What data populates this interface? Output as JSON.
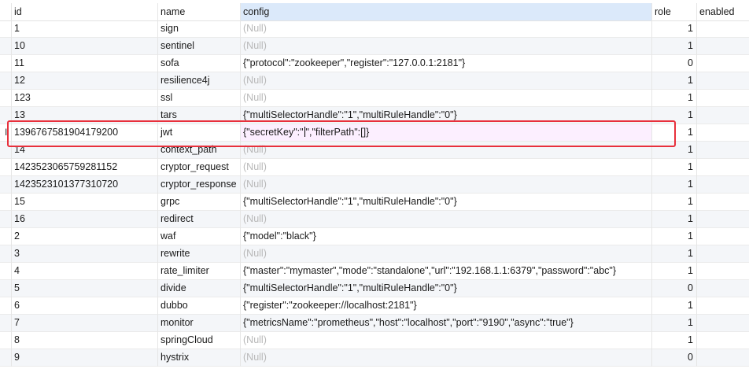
{
  "columns": {
    "id": "id",
    "name": "name",
    "config": "config",
    "role": "role",
    "enabled": "enabled"
  },
  "null_text": "(Null)",
  "editing": {
    "marker": "I",
    "id": "1396767581904179200",
    "name": "jwt",
    "config_before_caret": "{\"secretKey\":\"",
    "config_after_caret": "\",\"filterPath\":[]}",
    "role": "1"
  },
  "rows": [
    {
      "id": "1",
      "name": "sign",
      "config": null,
      "role": "1"
    },
    {
      "id": "10",
      "name": "sentinel",
      "config": null,
      "role": "1"
    },
    {
      "id": "11",
      "name": "sofa",
      "config": "{\"protocol\":\"zookeeper\",\"register\":\"127.0.0.1:2181\"}",
      "role": "0"
    },
    {
      "id": "12",
      "name": "resilience4j",
      "config": null,
      "role": "1"
    },
    {
      "id": "123",
      "name": "ssl",
      "config": null,
      "role": "1"
    },
    {
      "id": "13",
      "name": "tars",
      "config": "{\"multiSelectorHandle\":\"1\",\"multiRuleHandle\":\"0\"}",
      "role": "1"
    },
    {
      "id": "1396767581904179200",
      "name": "jwt",
      "config": "__editing__",
      "role": "1"
    },
    {
      "id": "14",
      "name": "context_path",
      "config": null,
      "role": "1"
    },
    {
      "id": "1423523065759281152",
      "name": "cryptor_request",
      "config": null,
      "role": "1"
    },
    {
      "id": "1423523101377310720",
      "name": "cryptor_response",
      "config": null,
      "role": "1"
    },
    {
      "id": "15",
      "name": "grpc",
      "config": "{\"multiSelectorHandle\":\"1\",\"multiRuleHandle\":\"0\"}",
      "role": "1"
    },
    {
      "id": "16",
      "name": "redirect",
      "config": null,
      "role": "1"
    },
    {
      "id": "2",
      "name": "waf",
      "config": "{\"model\":\"black\"}",
      "role": "1"
    },
    {
      "id": "3",
      "name": "rewrite",
      "config": null,
      "role": "1"
    },
    {
      "id": "4",
      "name": "rate_limiter",
      "config": "{\"master\":\"mymaster\",\"mode\":\"standalone\",\"url\":\"192.168.1.1:6379\",\"password\":\"abc\"}",
      "role": "1"
    },
    {
      "id": "5",
      "name": "divide",
      "config": "{\"multiSelectorHandle\":\"1\",\"multiRuleHandle\":\"0\"}",
      "role": "0"
    },
    {
      "id": "6",
      "name": "dubbo",
      "config": "{\"register\":\"zookeeper://localhost:2181\"}",
      "role": "1"
    },
    {
      "id": "7",
      "name": "monitor",
      "config": "{\"metricsName\":\"prometheus\",\"host\":\"localhost\",\"port\":\"9190\",\"async\":\"true\"}",
      "role": "1"
    },
    {
      "id": "8",
      "name": "springCloud",
      "config": null,
      "role": "1"
    },
    {
      "id": "9",
      "name": "hystrix",
      "config": null,
      "role": "0"
    }
  ],
  "colors": {
    "selected_header": "#dbe9fa",
    "row_alt": "#f4f6f9",
    "active_cell": "#fcefff",
    "null_text": "#b8b8b8",
    "highlight_box": "#e8303c"
  }
}
